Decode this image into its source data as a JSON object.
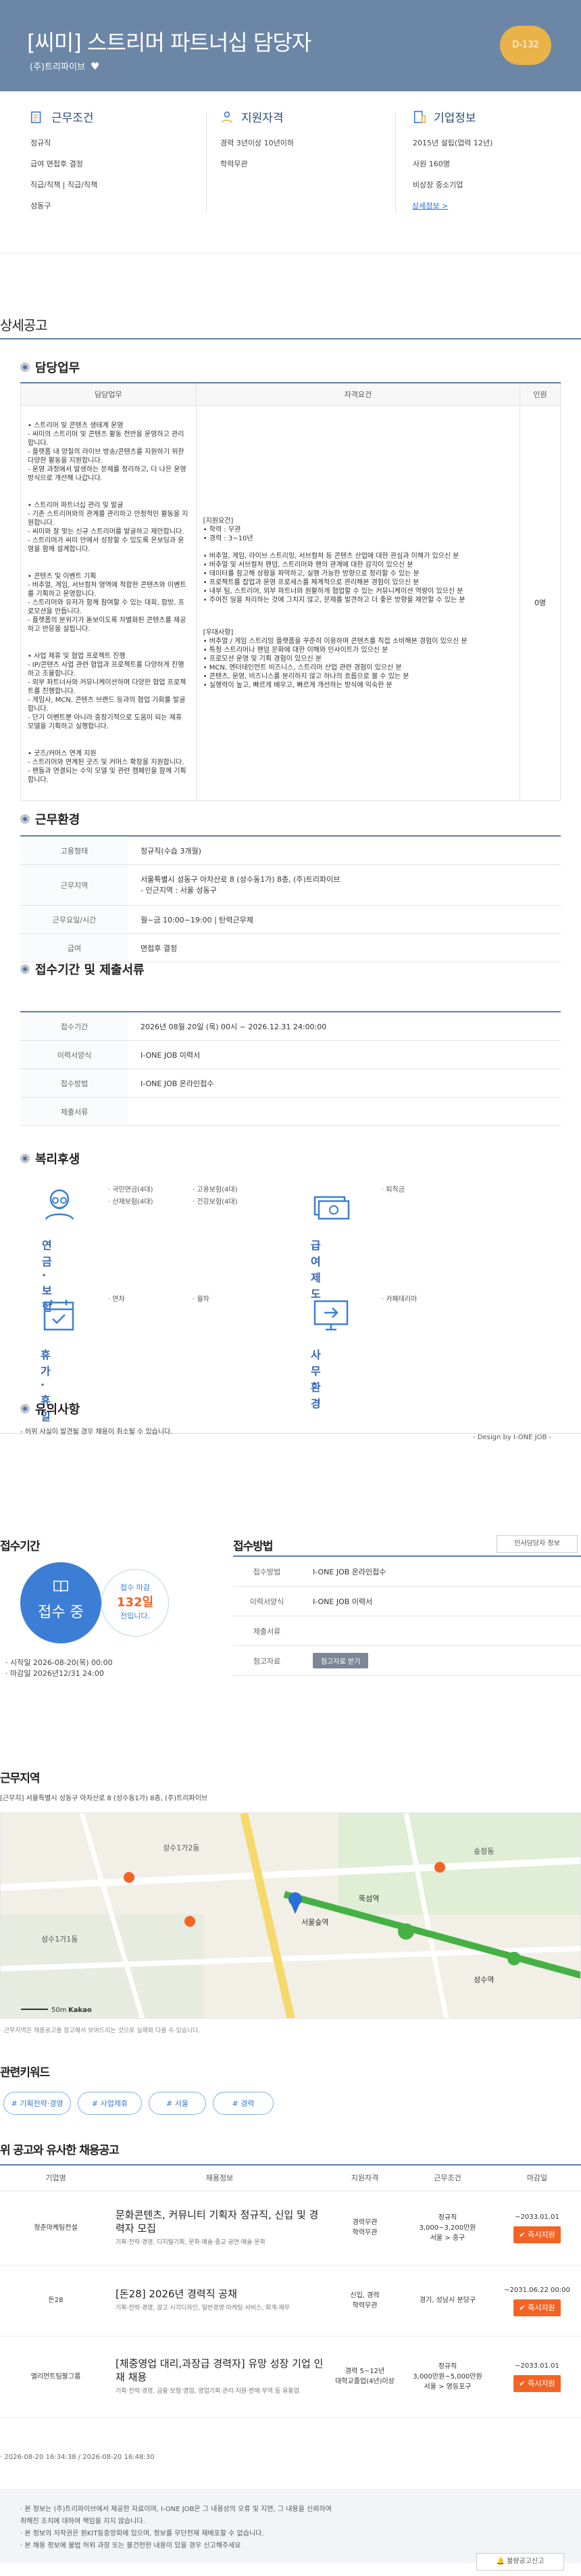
{
  "header": {
    "title": "[씨미] 스트리머 파트너십 담당자",
    "company": "(주)트리파이브",
    "dday": "D-132"
  },
  "summary": {
    "conditions": {
      "title": "근무조건",
      "items": [
        "정규직",
        "급여 면접후 결정",
        "직급/직책 | 직급/직책",
        "성동구"
      ]
    },
    "qualifications": {
      "title": "지원자격",
      "items": [
        "경력 3년이상 10년이하",
        "학력무관"
      ]
    },
    "company": {
      "title": "기업정보",
      "items": [
        "2015년 설립(업력 12년)",
        "사원 160명",
        "비상장 중소기업"
      ],
      "link": "상세정보 >"
    }
  },
  "detail_title": "상세공고",
  "duties": {
    "title": "담당업무",
    "columns": [
      "담당업무",
      "자격요건",
      "인원"
    ],
    "tasks": [
      "• 스트리머 및 콘텐츠 생태계 운영\n- 씨미의 스트리머 및 콘텐츠 활동 전반을 운영하고 관리합니다.\n- 플랫폼 내 양질의 라이브 방송/콘텐츠를 지원하기 위한 다양한 활동을 지원합니다.\n- 운영 과정에서 발생하는 문제를 정리하고, 더 나은 운영 방식으로 개선해 나갑니다.",
      "• 스트리머 파트너십 관리 및 발굴\n- 기존 스트리머와의 관계를 관리하고 안정적인 활동을 지원합니다.\n- 씨미와 잘 맞는 신규 스트리머를 발굴하고 제안합니다.\n- 스트리머가 씨미 안에서 성장할 수 있도록 온보딩과 운영을 함께 설계합니다.",
      "• 콘텐츠 및 이벤트 기획\n- 버추얼, 게임, 서브컬처 영역에 적합한 콘텐츠와 이벤트를 기획하고 운영합니다.\n- 스트리머와 유저가 함께 참여할 수 있는 대회, 합방, 프로모션을 만듭니다.\n- 플랫폼의 분위기가 돋보이도록 차별화된 콘텐츠를 제공하고 반응을 살핍니다.",
      "• 사업 제휴 및 협업 프로젝트 진행\n- IP/콘텐츠 사업 관련 협업과 프로젝트를 다양하게 진행하고 조율합니다.\n- 외부 파트너사와 커뮤니케이션하며 다양한 협업 프로젝트를 진행합니다.\n- 게임사, MCN, 콘텐츠 브랜드 등과의 협업 기회를 발굴합니다.\n- 단기 이벤트뿐 아니라 중장기적으로 도움이 되는 제휴 모델을 기획하고 실행합니다.",
      "• 굿즈/커머스 연계 지원\n- 스트리머와 연계된 굿즈 및 커머스 확장을 지원합니다.\n- 팬들과 연결되는 수익 모델 및 관련 캠페인을 함께 기획합니다."
    ],
    "requirements": "[지원요건]\n• 학력 : 무관\n• 경력 : 3~10년\n\n• 버추얼, 게임, 라이브 스트리밍, 서브컬처 등 콘텐츠 산업에 대한 관심과 이해가 있으신 분\n• 버추얼 및 서브컬처 팬덤, 스트리머와 팬의 관계에 대한 감각이 있으신 분\n• 데이터를 참고해 상황을 파악하고, 실행 가능한 방향으로 정리할 수 있는 분\n• 프로젝트를 잡업과 운영 프로세스를 체계적으로 관리해본 경험이 있으신 분\n• 내부 팀, 스트리머, 외부 파트너와 원활하게 협업할 수 있는 커뮤니케이션 역량이 있으신 분\n• 주어진 일을 처리하는 것에 그치지 않고, 문제를 발견하고 더 좋은 방향을 제안할 수 있는 분",
    "preferred": "[우대사항]\n• 버추얼 / 게임 스트리밍 플랫폼을 꾸준히 이용하며 콘텐츠를 직접 소비해본 경험이 있으신 분\n• 특정 스트리머나 팬덤 문화에 대한 이해와 인사이트가 있으신 분\n• 프로모션 운영 및 기획 경험이 있으신 분\n• MCN, 엔터테인먼트 비즈니스, 스트리머 산업 관련 경험이 있으신 분\n• 콘텐츠, 운영, 비즈니스를 분리하지 않고 하나의 흐름으로 볼 수 있는 분\n• 실행력이 높고, 빠르게 배우고, 빠르게 개선하는 방식에 익숙한 분",
    "headcount": "0명"
  },
  "environment": {
    "title": "근무환경",
    "rows": [
      {
        "k": "고용형태",
        "v": "정규직(수습 3개월)"
      },
      {
        "k": "근무지역",
        "v": "서울특별시 성동구 아차산로 8 (성수동1가) 8층, (주)트리파이브\n- 인근지역 : 서울 성동구"
      },
      {
        "k": "근무요일/시간",
        "v": "월~금 10:00~19:00 | 탄력근무제"
      },
      {
        "k": "급여",
        "v": "면접후 결정"
      }
    ]
  },
  "period": {
    "title": "접수기간 및 제출서류",
    "rows": [
      {
        "k": "접수기간",
        "v": "2026년 08월 20일 (목) 00시 ~ 2026.12.31 24:00:00"
      },
      {
        "k": "이력서양식",
        "v": "I-ONE JOB 이력서"
      },
      {
        "k": "접수방법",
        "v": "I-ONE JOB 온라인접수"
      },
      {
        "k": "제출서류",
        "v": ""
      }
    ]
  },
  "welfare": {
    "title": "복리후생",
    "groups": [
      {
        "label": "연금·보험",
        "items": [
          "· 국민연금(4대)",
          "· 고용보험(4대)",
          "· 산재보험(4대)",
          "· 건강보험(4대)"
        ]
      },
      {
        "label": "급여제도",
        "items": [
          "· 퇴직금"
        ]
      },
      {
        "label": "휴가·휴일",
        "items": [
          "· 연차",
          "· 월차"
        ]
      },
      {
        "label": "사무환경",
        "items": [
          "· 카페테리아"
        ]
      }
    ]
  },
  "notes": {
    "title": "유의사항",
    "text": "- 허위 사실이 발견될 경우 채용이 취소될 수 있습니다.",
    "design": "- Design by I-ONE JOB -"
  },
  "apply_period": {
    "title": "접수기간",
    "status": "접수 중",
    "deadline_label": "접수 마감",
    "days": "132일",
    "days_suffix": "전입니다.",
    "start": "· 시작일 2026-08-20(목) 00:00",
    "end": "· 마감일 2026년12/31 24:00"
  },
  "apply_method": {
    "title": "접수방법",
    "badge": "인사담당자 정보",
    "rows": [
      {
        "k": "접수방법",
        "v": "I-ONE JOB 온라인접수"
      },
      {
        "k": "이력서양식",
        "v": "I-ONE JOB 이력서"
      },
      {
        "k": "제출서류",
        "v": ""
      },
      {
        "k": "첨고자료",
        "v": "첨고자료 받기"
      }
    ]
  },
  "location": {
    "title": "근무지역",
    "address": "[근무지] 서울특별시 성동구 아차산로 8 (성수동1가) 8층, (주)트리파이브",
    "note": "· 근무지역은 채용공고를 참고해서 보여드리는 것으로 실제와 다를 수 있습니다.",
    "scale": "50m",
    "brand": "Kakao",
    "places": [
      "성수1가2동",
      "서울숲역",
      "성수1가1동",
      "뚝섬역",
      "송정동",
      "성수역"
    ]
  },
  "keywords": {
    "title": "관련키워드",
    "items": [
      "# 기획전략·경영",
      "# 사업제휴",
      "# 서울",
      "# 경력"
    ]
  },
  "similar": {
    "title": "위 공고와 유사한 채용공고",
    "columns": [
      "기업명",
      "채용정보",
      "지원자격",
      "근무조건",
      "마감일"
    ],
    "rows": [
      {
        "company": "청춘마케팅컨설",
        "title": "문화콘텐츠, 커뮤니티 기획자 정규직, 신입 및 경력자 모집",
        "sub": "기획·전략·경영, 디지털기획, 문화·예술·종교·공연·예술·문화",
        "qual": "경력무관\n학력무관",
        "cond": "정규직\n3,000~3,200만원\n서울 > 중구",
        "deadline": "~2033.01.01",
        "btn": "즉시지원"
      },
      {
        "company": "돈28",
        "title": "[돈28] 2026년 경력직 공채",
        "sub": "기획·전략·경영, 광고·시각디자인, 일반경영·마케팅·서비스, 회계·재무",
        "qual": "신입, 경력\n학력무관",
        "cond": "경기, 성남시 분당구",
        "deadline": "~2031.06.22 00:00",
        "btn": "즉시지원"
      },
      {
        "company": "엘리먼트팀팔그룹",
        "title": "[체중영업 대리,과장급 경력자] 유망 성장 기업 인재 채용",
        "sub": "기획·전략·경영, 금융·보험·영업, 영업기획·관리·지원·판매·무역 등 유통업",
        "qual": "경력 5~12년\n대학교졸업(4년)이상",
        "cond": "정규직\n3,000만원~5,000만원\n서울 > 영등포구",
        "deadline": "~2033.01.01",
        "btn": "즉시지원"
      }
    ]
  },
  "dates": "· 2026-08-20 16:34:38 / 2026-08-20 16:48:30",
  "footer": {
    "lines": [
      "· 본 정보는 (주)트리파이브에서 제공한 자료이며, I-ONE JOB은 그 내용상의 오류 및 지연, 그 내용을 신뢰하여",
      "   취해진 조치에 대하여 책임을 지지 않습니다.",
      "· 본 정보의 저작권은 원KIT등중앙회에 있으며, 정보를 무단전재 재배포할 수 없습니다.",
      "· 본 채용 정보에 불법 허위 과장 또는 불건전한 내용이 있을 경우 신고해주세요"
    ],
    "report": "불량공고신고"
  },
  "colors": {
    "banner": "#6c86a6",
    "accent": "#3c7ed6",
    "orange": "#f36424",
    "navy": "#2b4d78"
  }
}
